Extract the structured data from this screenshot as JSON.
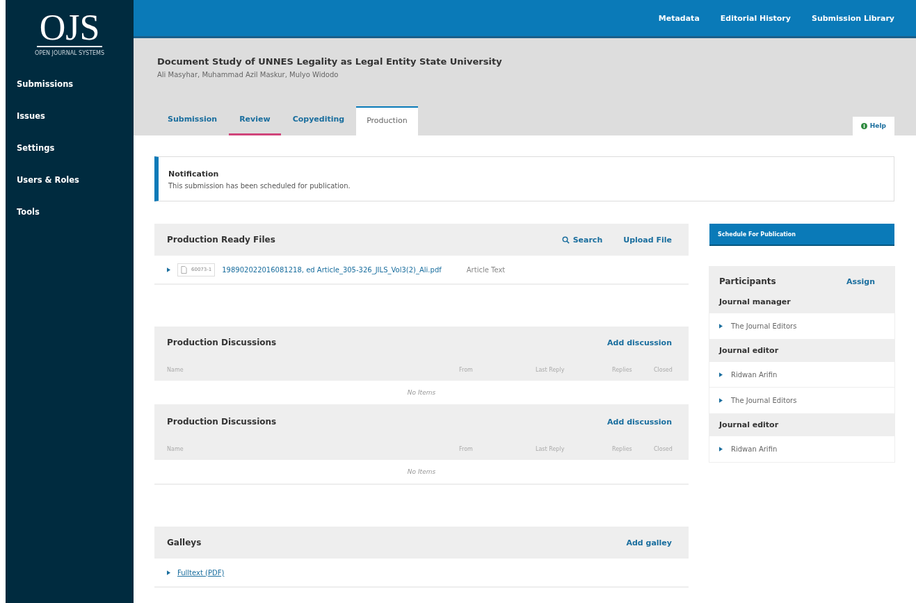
{
  "logo": {
    "text": "OJS",
    "tagline": "OPEN JOURNAL SYSTEMS"
  },
  "sidebar": {
    "items": [
      "Submissions",
      "Issues",
      "Settings",
      "Users & Roles",
      "Tools"
    ]
  },
  "top_links": [
    "Metadata",
    "Editorial History",
    "Submission Library"
  ],
  "submission": {
    "title": "Document Study of UNNES Legality as Legal Entity State University",
    "authors": "Ali Masyhar, Muhammad Azil Maskur, Mulyo Widodo"
  },
  "tabs": [
    {
      "label": "Submission",
      "selected": false,
      "focused": false
    },
    {
      "label": "Review",
      "selected": false,
      "focused": true
    },
    {
      "label": "Copyediting",
      "selected": false,
      "focused": false
    },
    {
      "label": "Production",
      "selected": true,
      "focused": false
    }
  ],
  "help": "Help",
  "notification": {
    "title": "Notification",
    "text": "This submission has been scheduled for publication."
  },
  "files_panel": {
    "title": "Production Ready Files",
    "search": "Search",
    "action": "Upload File",
    "rows": [
      {
        "id": "60073-1",
        "name": "198902022016081218, ed Article_305-326_JILS_Vol3(2)_Ali.pdf",
        "type": "Article Text"
      }
    ]
  },
  "discussion_panels": [
    {
      "title": "Production Discussions",
      "action": "Add discussion",
      "columns": [
        "Name",
        "From",
        "Last Reply",
        "Replies",
        "Closed"
      ],
      "empty": "No Items"
    },
    {
      "title": "Production Discussions",
      "action": "Add discussion",
      "columns": [
        "Name",
        "From",
        "Last Reply",
        "Replies",
        "Closed"
      ],
      "empty": "No Items"
    }
  ],
  "galleys": {
    "title": "Galleys",
    "action": "Add galley",
    "rows": [
      "Fulltext (PDF)"
    ]
  },
  "schedule_button": "Schedule For Publication",
  "participants": {
    "title": "Participants",
    "action": "Assign",
    "groups": [
      {
        "role": "Journal manager",
        "people": [
          "The Journal Editors"
        ]
      },
      {
        "role": "Journal editor",
        "people": [
          "Ridwan Arifin"
        ]
      }
    ]
  },
  "participants_extra": {
    "groups": [
      {
        "people": [
          "The Journal Editors"
        ]
      },
      {
        "role": "Journal editor",
        "people": [
          "Ridwan Arifin"
        ]
      }
    ]
  }
}
